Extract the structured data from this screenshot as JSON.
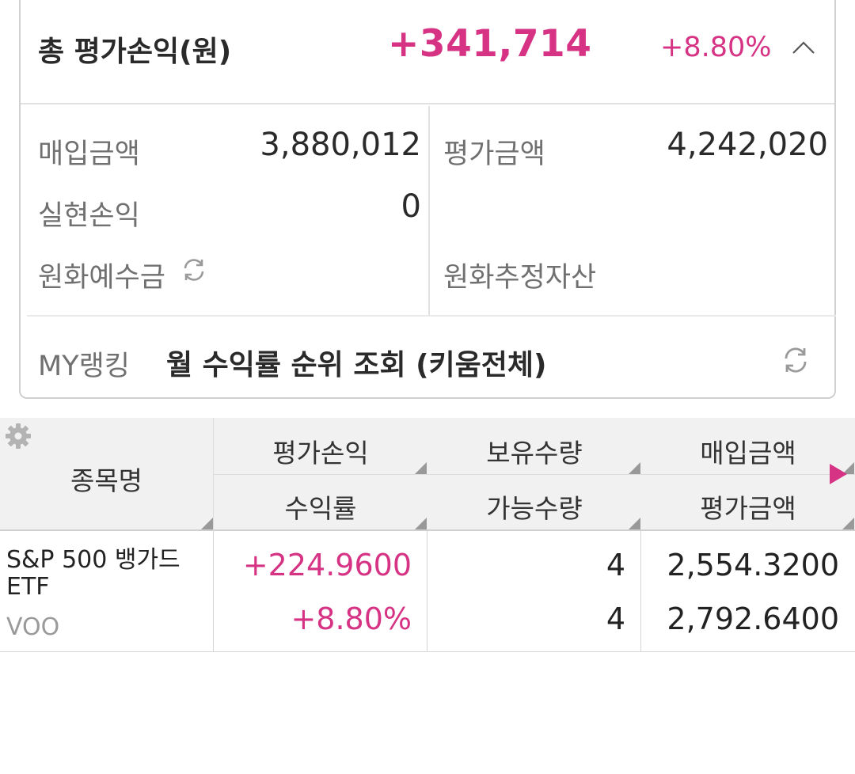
{
  "summary": {
    "title": "총 평가손익(원)",
    "total_pnl": "+341,714",
    "total_rate": "+8.80%",
    "collapse_icon": "chevron-up-icon",
    "purchase_label": "매입금액",
    "purchase_value": "3,880,012",
    "valuation_label": "평가금액",
    "valuation_value": "4,242,020",
    "realized_label": "실현손익",
    "realized_value": "0",
    "krw_deposit_label": "원화예수금",
    "krw_deposit_icon": "refresh-icon",
    "krw_estimated_label": "원화추정자산"
  },
  "ranking": {
    "label": "MY랭킹",
    "text": "월 수익률 순위 조회 (키움전체)",
    "icon": "refresh-icon"
  },
  "table": {
    "settings_icon": "gear-icon",
    "next_icon": "arrow-right-icon",
    "headers": {
      "name": "종목명",
      "pnl": "평가손익",
      "rate": "수익률",
      "holding_qty": "보유수량",
      "available_qty": "가능수량",
      "purchase_amount": "매입금액",
      "valuation_amount": "평가금액"
    },
    "rows": [
      {
        "name": "S&P 500 뱅가드 ETF",
        "code": "VOO",
        "pnl": "+224.9600",
        "rate": "+8.80%",
        "holding_qty": "4",
        "available_qty": "4",
        "purchase_amount": "2,554.3200",
        "valuation_amount": "2,792.6400"
      }
    ]
  },
  "colors": {
    "accent_up": "#d63384",
    "header_bg": "#f1f1f1"
  }
}
